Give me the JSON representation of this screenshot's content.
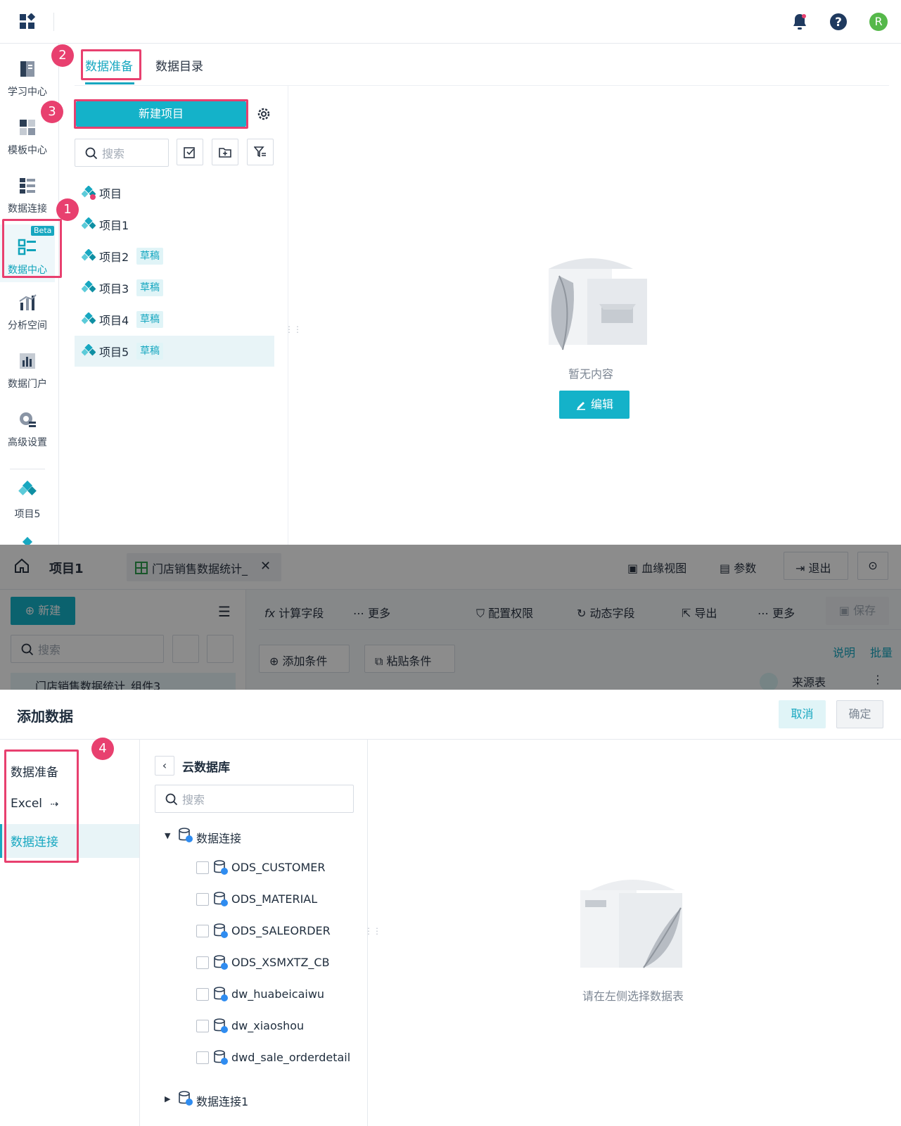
{
  "top": {
    "avatar_letter": "R",
    "icons": [
      "grid-icon",
      "bell-icon",
      "help-icon"
    ],
    "nav": [
      {
        "label": "学习中心",
        "icon": "book-icon"
      },
      {
        "label": "模板中心",
        "icon": "template-icon"
      },
      {
        "label": "数据连接",
        "icon": "data-connection-icon"
      },
      {
        "label": "数据中心",
        "icon": "data-center-icon",
        "badge": "Beta",
        "active": true
      },
      {
        "label": "分析空间",
        "icon": "analysis-icon"
      },
      {
        "label": "数据门户",
        "icon": "portal-icon"
      },
      {
        "label": "高级设置",
        "icon": "settings-icon"
      },
      {
        "label": "项目5",
        "icon": "project-icon"
      }
    ],
    "tabs": [
      {
        "label": "数据准备",
        "active": true
      },
      {
        "label": "数据目录"
      }
    ],
    "new_project": "新建项目",
    "search_placeholder": "搜索",
    "projects": [
      {
        "label": "项目",
        "draft": ""
      },
      {
        "label": "项目1",
        "draft": ""
      },
      {
        "label": "项目2",
        "draft": "草稿"
      },
      {
        "label": "项目3",
        "draft": "草稿"
      },
      {
        "label": "项目4",
        "draft": "草稿"
      },
      {
        "label": "项目5",
        "draft": "草稿",
        "selected": true
      }
    ],
    "empty_text": "暂无内容",
    "edit_button": "编辑",
    "steps": [
      "1",
      "2",
      "3"
    ]
  },
  "editor": {
    "project_title": "项目1",
    "doc_tab": "门店销售数据统计_",
    "lineage": "血缘视图",
    "params": "参数",
    "exit": "退出",
    "new": "新建",
    "search_placeholder": "搜索",
    "calc_field": "计算字段",
    "more1": "更多",
    "perm": "配置权限",
    "dynamic": "动态字段",
    "export": "导出",
    "more2": "更多",
    "save": "保存",
    "add_cond": "添加条件",
    "paste_cond": "粘贴条件",
    "explain": "说明",
    "batch": "批量",
    "source_table": "来源表",
    "list_item": "门店销售数据统计_组件3"
  },
  "dialog": {
    "title": "添加数据",
    "cancel": "取消",
    "confirm": "确定",
    "step": "4",
    "sources": [
      "数据准备",
      "Excel",
      "数据连接"
    ],
    "db_title": "云数据库",
    "search_placeholder": "搜索",
    "tree_root": "数据连接",
    "tables": [
      "ODS_CUSTOMER",
      "ODS_MATERIAL",
      "ODS_SALEORDER",
      "ODS_XSMXTZ_CB",
      "dw_huabeicaiwu",
      "dw_xiaoshou",
      "dwd_sale_orderdetail"
    ],
    "tree_root2": "数据连接1",
    "empty_text": "请在左侧选择数据表"
  },
  "colors": {
    "accent": "#14b2c9",
    "highlight": "#e8406f",
    "avatar": "#55b84a"
  }
}
